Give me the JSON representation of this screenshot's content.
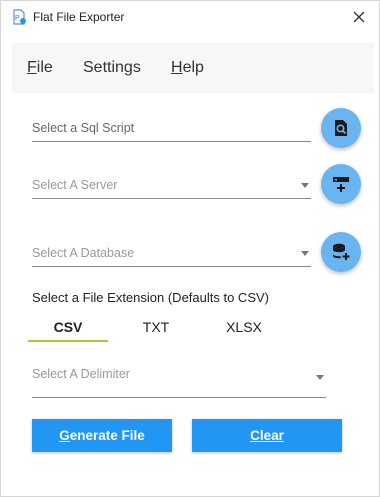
{
  "window": {
    "title": "Flat File Exporter",
    "close_icon": "close-icon",
    "app_icon": "flat-file-icon"
  },
  "menu": {
    "items": [
      {
        "access_key": "F",
        "rest": "ile"
      },
      {
        "label": "Settings"
      },
      {
        "access_key": "H",
        "rest": "elp"
      }
    ]
  },
  "fields": {
    "sql_script": {
      "placeholder": "Select a Sql Script",
      "button_icon": "search-file-icon"
    },
    "server": {
      "placeholder": "Select A Server",
      "button_icon": "add-server-icon"
    },
    "database": {
      "placeholder": "Select A Database",
      "button_icon": "add-database-icon"
    },
    "delimiter": {
      "placeholder": "Select A Delimiter"
    }
  },
  "file_extension": {
    "label": "Select a File Extension (Defaults to CSV)",
    "tabs": [
      "CSV",
      "TXT",
      "XLSX"
    ],
    "selected": "CSV",
    "accent_color": "#a7c938"
  },
  "actions": {
    "generate": {
      "access_key": "G",
      "rest": "enerate File"
    },
    "clear": {
      "access_key": "C",
      "rest": "lear"
    },
    "button_color": "#2196f3",
    "fab_color": "#6ab4f0"
  }
}
